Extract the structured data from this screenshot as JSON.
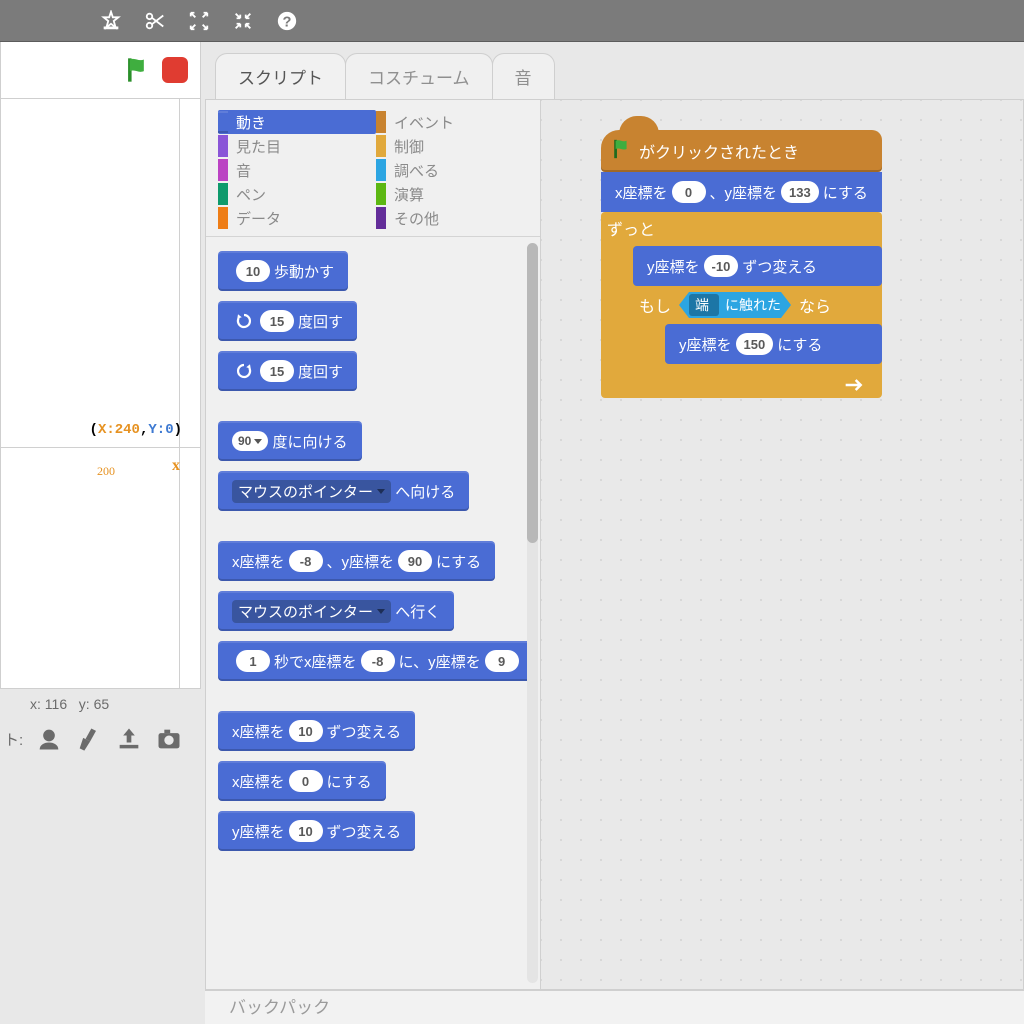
{
  "topbar": {
    "icons": [
      "stamp",
      "scissors",
      "expand",
      "shrink",
      "help"
    ]
  },
  "stage": {
    "pos_x_key": "X:",
    "pos_x": "240",
    "pos_y_key": "Y:",
    "pos_y": "0",
    "axis200": "200",
    "axisx": "x",
    "mouse_label_x": "x:",
    "mouse_x": "116",
    "mouse_label_y": "y:",
    "mouse_y": "65",
    "sprite_tools_prefix": "ト:"
  },
  "tabs": {
    "scripts": "スクリプト",
    "costumes": "コスチューム",
    "sounds": "音"
  },
  "categories": {
    "motion": "動き",
    "looks": "見た目",
    "sound": "音",
    "pen": "ペン",
    "data": "データ",
    "events": "イベント",
    "control": "制御",
    "sensing": "調べる",
    "operators": "演算",
    "more": "その他"
  },
  "palette": {
    "move": {
      "v": "10",
      "t": "歩動かす"
    },
    "turn_cw": {
      "v": "15",
      "t": "度回す"
    },
    "turn_ccw": {
      "v": "15",
      "t": "度回す"
    },
    "point_dir": {
      "v": "90",
      "t": "度に向ける"
    },
    "point_towards": {
      "dd": "マウスのポインター",
      "t": "へ向ける"
    },
    "goto_xy": {
      "pre": "x座標を",
      "x": "-8",
      "mid": "、y座標を",
      "y": "90",
      "suf": "にする"
    },
    "goto": {
      "dd": "マウスのポインター",
      "t": "へ行く"
    },
    "glide": {
      "secs": "1",
      "p1": "秒でx座標を",
      "x": "-8",
      "p2": "に、y座標を",
      "y": "9"
    },
    "change_x": {
      "pre": "x座標を",
      "v": "10",
      "suf": "ずつ変える"
    },
    "set_x": {
      "pre": "x座標を",
      "v": "0",
      "suf": "にする"
    },
    "change_y": {
      "pre": "y座標を",
      "v": "10",
      "suf": "ずつ変える"
    }
  },
  "script": {
    "hat": "がクリックされたとき",
    "goto": {
      "pre": "x座標を",
      "x": "0",
      "mid": "、y座標を",
      "y": "133",
      "suf": "にする"
    },
    "forever": "ずっと",
    "chy": {
      "pre": "y座標を",
      "v": "-10",
      "suf": "ずつ変える"
    },
    "if_pre": "もし",
    "touch": "に触れた",
    "edge": "端",
    "if_suf": "なら",
    "sety": {
      "pre": "y座標を",
      "v": "150",
      "suf": "にする"
    },
    "loop_arrow": "↻"
  },
  "backpack": "バックパック"
}
